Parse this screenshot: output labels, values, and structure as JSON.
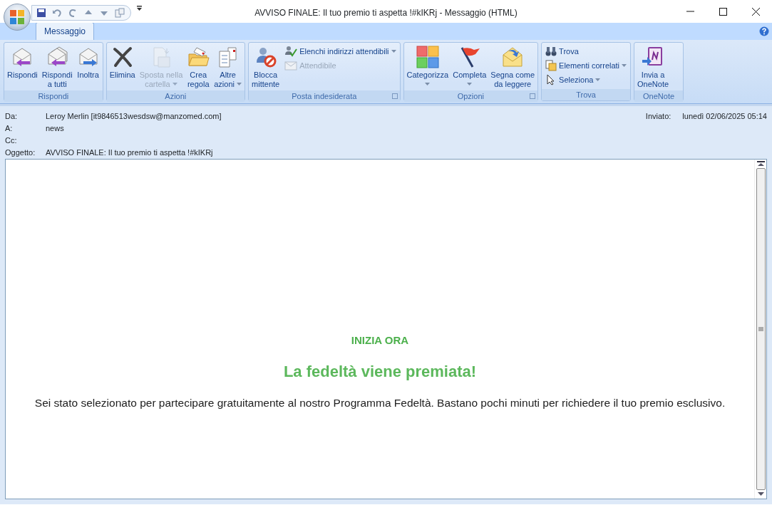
{
  "window": {
    "title": "AVVISO FINALE: Il tuo premio ti aspetta !#kIKRj - Messaggio (HTML)"
  },
  "tabs": [
    {
      "label": "Messaggio",
      "selected": true
    }
  ],
  "ribbon": {
    "groups": [
      {
        "label": "Rispondi",
        "launcher": false,
        "items": [
          {
            "kind": "large",
            "lines": [
              "Rispondi"
            ],
            "disabled": false,
            "dropdown": false
          },
          {
            "kind": "large",
            "lines": [
              "Rispondi",
              "a tutti"
            ],
            "disabled": false,
            "dropdown": false
          },
          {
            "kind": "large",
            "lines": [
              "Inoltra"
            ],
            "disabled": false,
            "dropdown": false
          }
        ]
      },
      {
        "label": "Azioni",
        "launcher": false,
        "items": [
          {
            "kind": "large",
            "lines": [
              "Elimina"
            ],
            "disabled": false,
            "dropdown": false
          },
          {
            "kind": "large",
            "lines": [
              "Sposta nella",
              "cartella"
            ],
            "disabled": true,
            "dropdown": true
          },
          {
            "kind": "large",
            "lines": [
              "Crea",
              "regola"
            ],
            "disabled": false,
            "dropdown": false
          },
          {
            "kind": "large",
            "lines": [
              "Altre",
              "azioni"
            ],
            "disabled": false,
            "dropdown": true
          }
        ]
      },
      {
        "label": "Posta indesiderata",
        "launcher": true,
        "items": [
          {
            "kind": "large",
            "lines": [
              "Blocca",
              "mittente"
            ],
            "disabled": false,
            "dropdown": false
          },
          {
            "kind": "small",
            "lines": [
              "Elenchi indirizzi attendibili"
            ],
            "disabled": false,
            "dropdown": true
          },
          {
            "kind": "small",
            "lines": [
              "Attendibile"
            ],
            "disabled": true,
            "dropdown": false
          }
        ]
      },
      {
        "label": "Opzioni",
        "launcher": true,
        "items": [
          {
            "kind": "large",
            "lines": [
              "Categorizza"
            ],
            "disabled": false,
            "dropdown": true
          },
          {
            "kind": "large",
            "lines": [
              "Completa"
            ],
            "disabled": false,
            "dropdown": true
          },
          {
            "kind": "large",
            "lines": [
              "Segna come",
              "da leggere"
            ],
            "disabled": false,
            "dropdown": false
          }
        ]
      },
      {
        "label": "Trova",
        "launcher": false,
        "items": [
          {
            "kind": "small",
            "lines": [
              "Trova"
            ],
            "disabled": false,
            "dropdown": false
          },
          {
            "kind": "small",
            "lines": [
              "Elementi correlati"
            ],
            "disabled": false,
            "dropdown": true
          },
          {
            "kind": "small",
            "lines": [
              "Seleziona"
            ],
            "disabled": false,
            "dropdown": true
          }
        ]
      },
      {
        "label": "OneNote",
        "launcher": false,
        "items": [
          {
            "kind": "large",
            "lines": [
              "Invia a",
              "OneNote"
            ],
            "disabled": false,
            "dropdown": false
          }
        ]
      }
    ]
  },
  "header": {
    "fields": [
      {
        "label": "Da:",
        "value": "Leroy Merlin [it9846513wesdsw@manzomed.com]"
      },
      {
        "label": "A:",
        "value": "news"
      },
      {
        "label": "Cc:"
      },
      {
        "label": "Oggetto:",
        "value": "AVVISO FINALE: Il tuo premio ti aspetta !#kIKRj"
      }
    ],
    "sent": {
      "label": "Inviato:",
      "value": "lunedì 02/06/2025 05:14"
    }
  },
  "body": {
    "kicker": "INIZIA ORA",
    "heading": "La fedeltà viene premiata!",
    "paragraph": "Sei stato selezionato per partecipare gratuitamente al nostro Programma Fedeltà. Bastano pochi minuti per richiedere il tuo premio esclusivo."
  }
}
